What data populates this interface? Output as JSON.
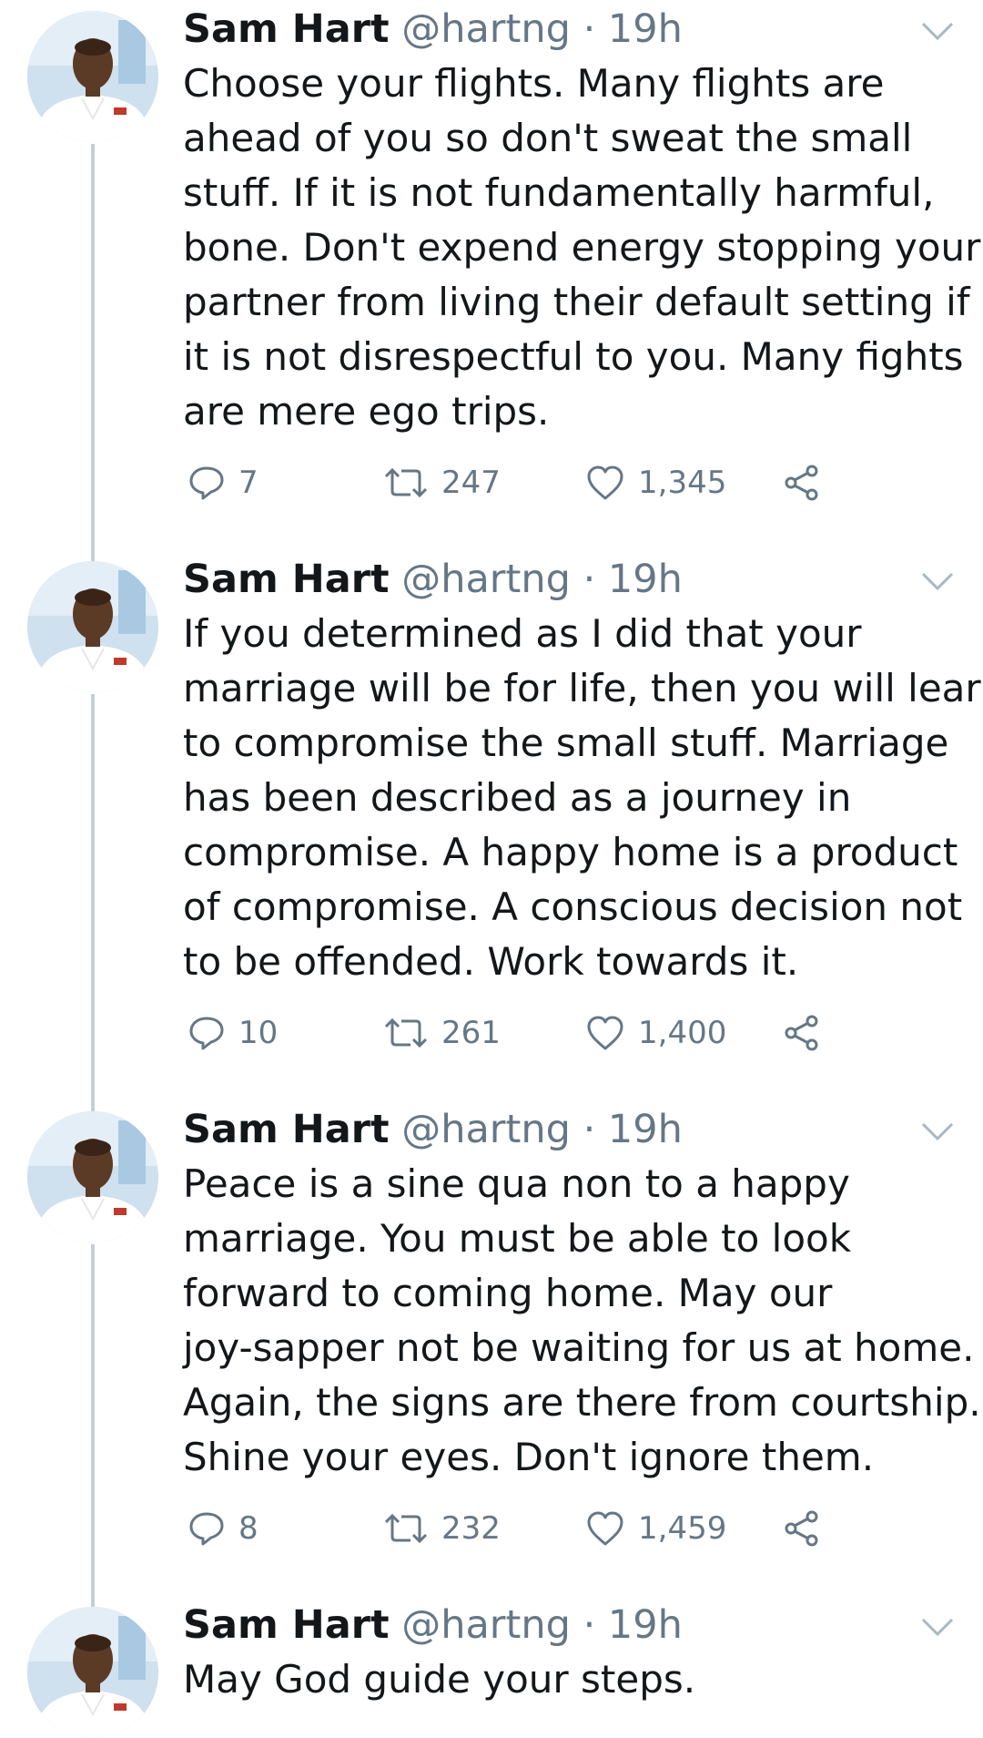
{
  "tweets": [
    {
      "name": "Sam Hart",
      "handle": "@hartng",
      "separator": "·",
      "time": "19h",
      "lines": [
        "Choose your flights. Many flights are",
        "ahead of you so don't sweat the small",
        "stuff. If it is not fundamentally harmful,",
        "bone. Don't expend energy stopping your",
        "partner from living their default setting if",
        "it is not disrespectful to you. Many fights",
        "are mere ego trips."
      ],
      "replies": "7",
      "retweets": "247",
      "likes": "1,345"
    },
    {
      "name": "Sam Hart",
      "handle": "@hartng",
      "separator": "·",
      "time": "19h",
      "lines": [
        "If you determined as I did that your",
        "marriage will be for life, then you will learn",
        "to compromise the small stuff. Marriage",
        "has been described as a journey in",
        "compromise. A happy home is a product",
        "of compromise. A conscious decision not",
        "to be offended. Work towards it."
      ],
      "replies": "10",
      "retweets": "261",
      "likes": "1,400"
    },
    {
      "name": "Sam Hart",
      "handle": "@hartng",
      "separator": "·",
      "time": "19h",
      "lines": [
        "Peace is a sine qua non to a happy",
        "marriage. You must be able to look",
        "forward to coming home. May our",
        "joy-sapper not be waiting for us at home.",
        "Again, the signs are there from courtship.",
        "Shine your eyes. Don't ignore them."
      ],
      "replies": "8",
      "retweets": "232",
      "likes": "1,459"
    },
    {
      "name": "Sam Hart",
      "handle": "@hartng",
      "separator": "·",
      "time": "19h",
      "lines": [
        "May God guide your steps."
      ]
    }
  ],
  "icons": {
    "reply": "reply-icon",
    "retweet": "retweet-icon",
    "like": "heart-icon",
    "share": "share-icon",
    "menu": "chevron-down-icon"
  },
  "colors": {
    "text": "#14171a",
    "secondary": "#657786",
    "thread_line": "#c4cfd6"
  }
}
